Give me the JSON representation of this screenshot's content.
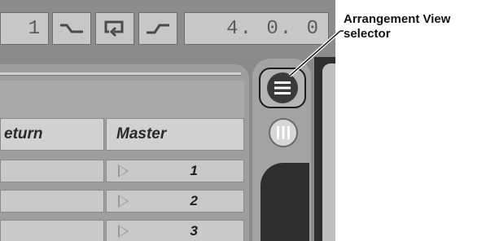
{
  "transport": {
    "left_field": "1",
    "position": "4.  0.  0"
  },
  "mixer": {
    "columns": [
      "eturn",
      "Master"
    ],
    "scenes": [
      "1",
      "2",
      "3"
    ]
  },
  "view_selector": {
    "arrangement_icon": "arrangement-view-icon",
    "session_icon": "session-view-icon"
  },
  "callout": {
    "label": "Arrangement View selector"
  }
}
